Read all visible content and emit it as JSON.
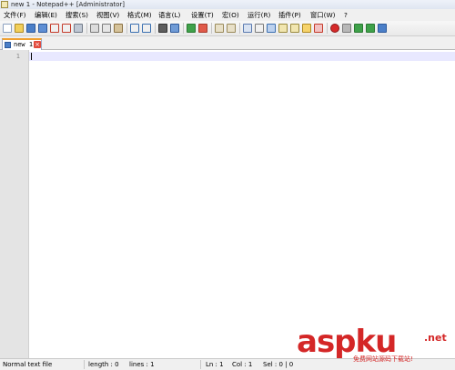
{
  "window": {
    "title": "new 1 - Notepad++ [Administrator]"
  },
  "menu": [
    "文件(F)",
    "编辑(E)",
    "搜索(S)",
    "视图(V)",
    "格式(M)",
    "语言(L)",
    "设置(T)",
    "宏(O)",
    "运行(R)",
    "插件(P)",
    "窗口(W)",
    "?"
  ],
  "toolbar": {
    "icons": [
      "new-file-icon",
      "open-file-icon",
      "save-icon",
      "save-all-icon",
      "close-icon",
      "close-all-icon",
      "print-icon",
      "cut-icon",
      "copy-icon",
      "paste-icon",
      "undo-icon",
      "redo-icon",
      "find-icon",
      "replace-icon",
      "zoom-in-icon",
      "zoom-out-icon",
      "sync-vertical-icon",
      "sync-horizontal-icon",
      "word-wrap-icon",
      "show-all-chars-icon",
      "indent-guide-icon",
      "document-map-icon",
      "function-list-icon",
      "folder-as-workspace-icon",
      "monitoring-icon",
      "record-macro-icon",
      "stop-record-icon",
      "play-macro-icon",
      "run-macro-multiple-icon",
      "save-macro-icon"
    ]
  },
  "tabs": [
    {
      "label": "new 1",
      "active": true
    }
  ],
  "editor": {
    "line_numbers": [
      "1"
    ],
    "content": ""
  },
  "status": {
    "lang": "Normal text file",
    "length": "length : 0",
    "lines": "lines : 1",
    "ln": "Ln : 1",
    "col": "Col : 1",
    "sel": "Sel : 0 | 0"
  },
  "watermark": {
    "brand": "aspku",
    "tld": ".net",
    "tagline": "免费网站源码下载站!"
  },
  "colors": {
    "accent": "#f0a030",
    "current_line": "#e8e8ff",
    "watermark": "#d42727"
  }
}
